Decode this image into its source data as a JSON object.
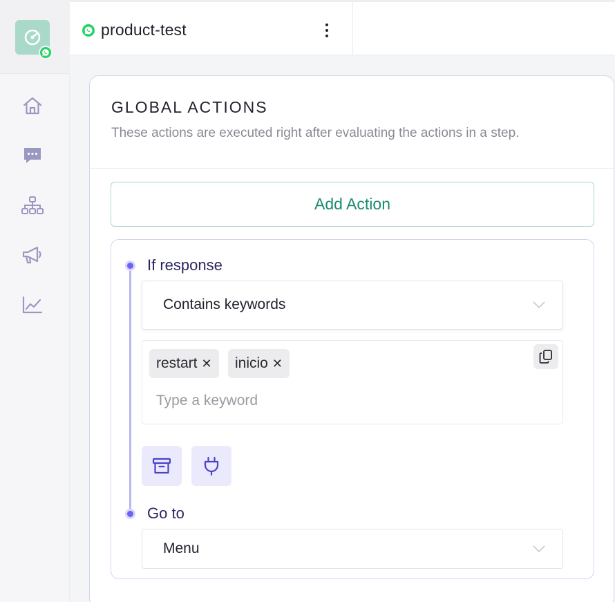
{
  "sidebar": {
    "icons": [
      "home-icon",
      "chat-icon",
      "flow-icon",
      "megaphone-icon",
      "analytics-icon"
    ]
  },
  "topbar": {
    "bot_name": "product-test"
  },
  "global_actions": {
    "title": "GLOBAL ACTIONS",
    "subtitle": "These actions are executed right after evaluating the actions in a step.",
    "add_action_label": "Add Action",
    "if_response_label": "If response",
    "condition_value": "Contains keywords",
    "keywords": [
      "restart",
      "inicio"
    ],
    "keyword_placeholder": "Type a keyword",
    "go_to_label": "Go to",
    "go_to_value": "Menu"
  },
  "colors": {
    "accent": "#6b63f2",
    "green": "#1a8a72",
    "whatsapp": "#25d366"
  }
}
